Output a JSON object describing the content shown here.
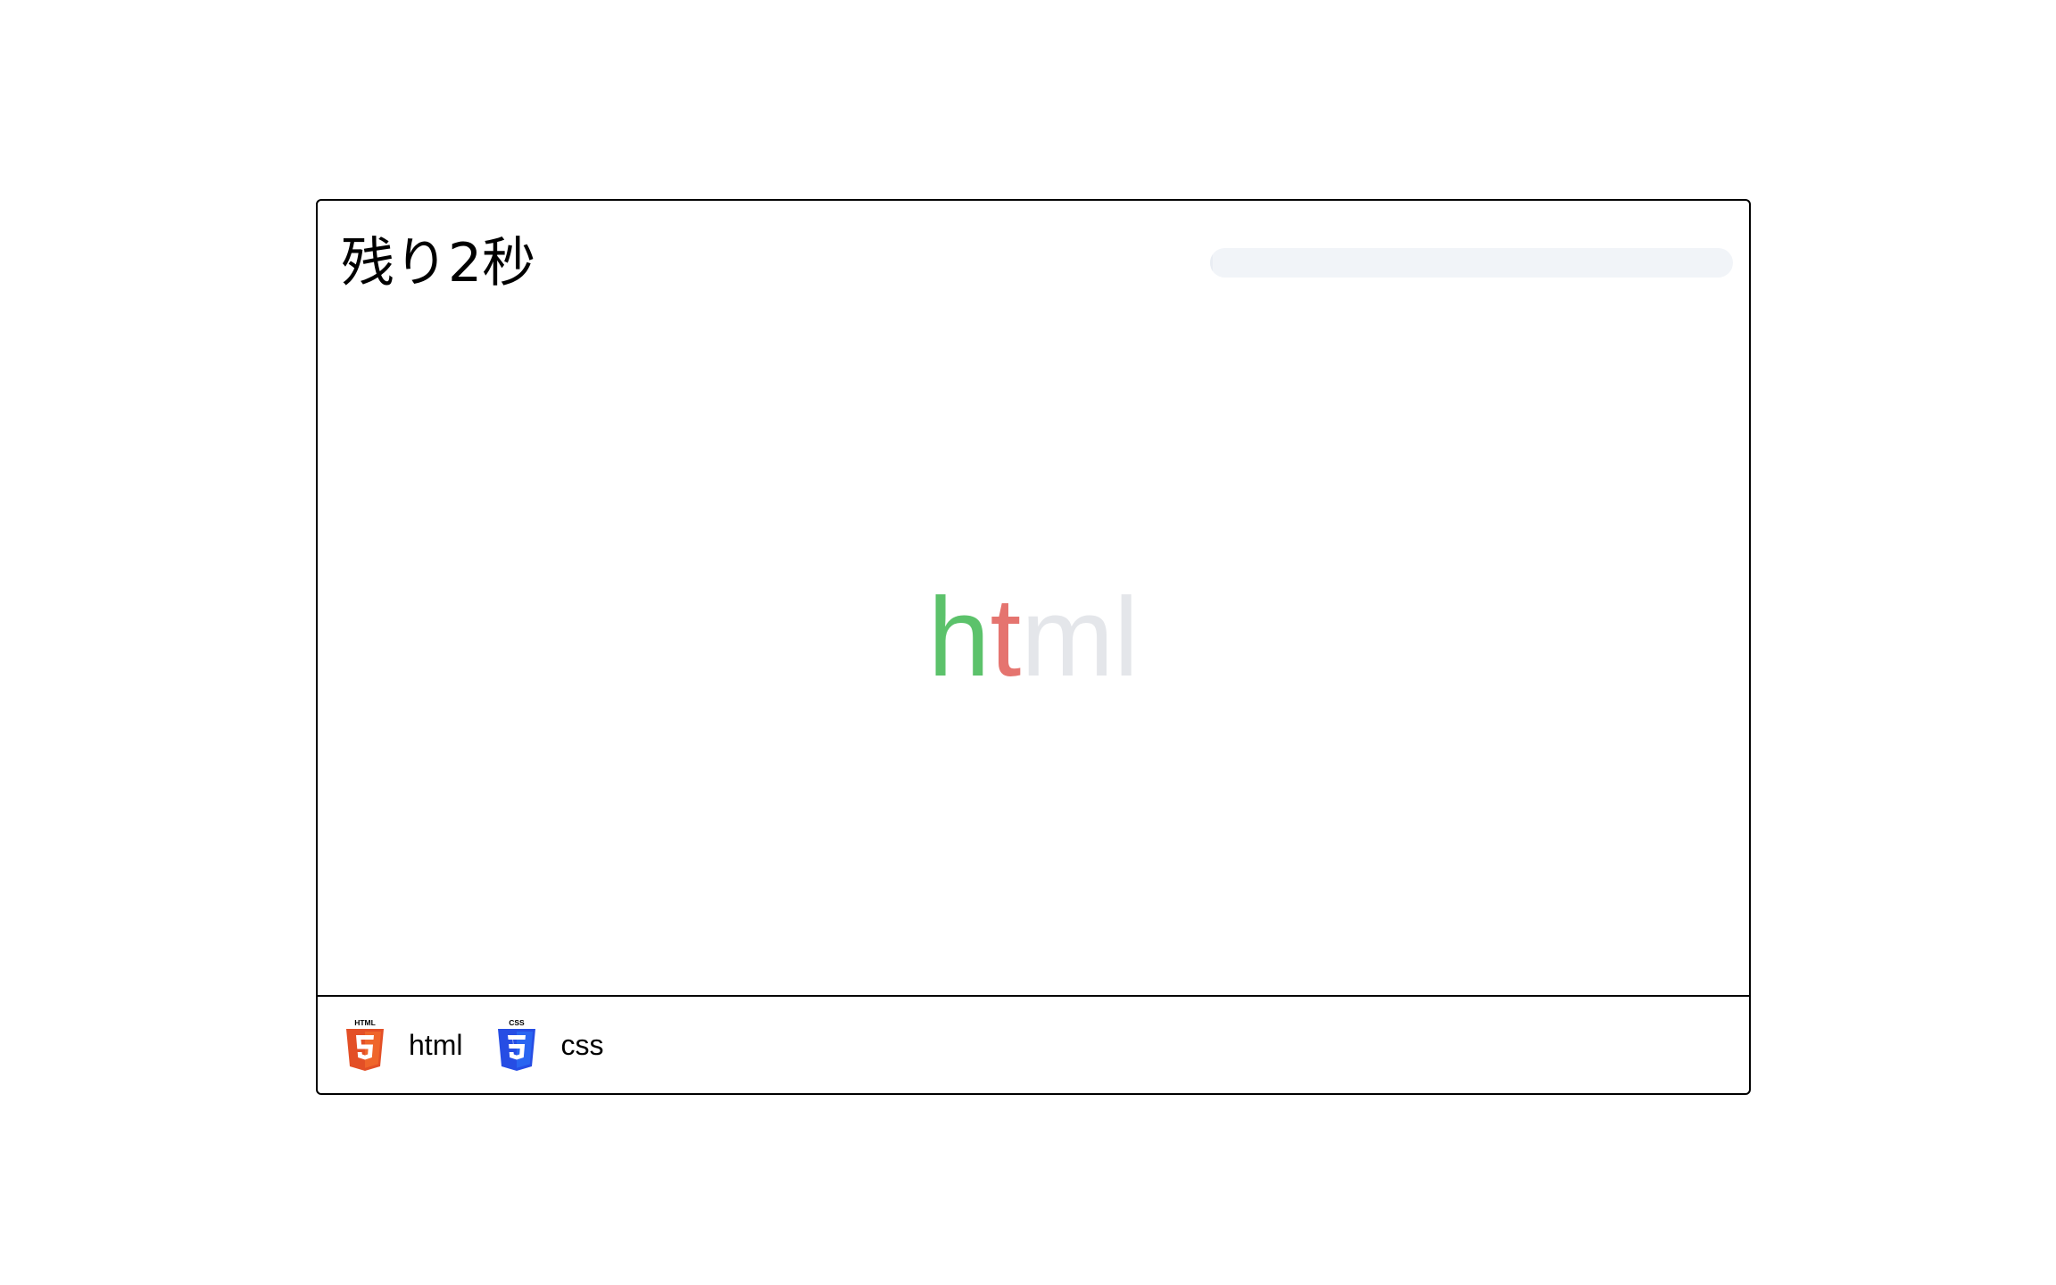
{
  "timer": {
    "label": "残り2秒",
    "remaining_fraction": 0.005
  },
  "word": {
    "typed": "h",
    "error": "t",
    "pending": "ml"
  },
  "colors": {
    "typed": "#5cc26b",
    "error": "#e5746f",
    "pending": "#e4e6ea",
    "html_badge": "#e34f26",
    "css_badge": "#264de4"
  },
  "languages": [
    {
      "label": "html",
      "icon": "html5-icon",
      "badge_text": "HTML"
    },
    {
      "label": "css",
      "icon": "css3-icon",
      "badge_text": "CSS"
    }
  ]
}
